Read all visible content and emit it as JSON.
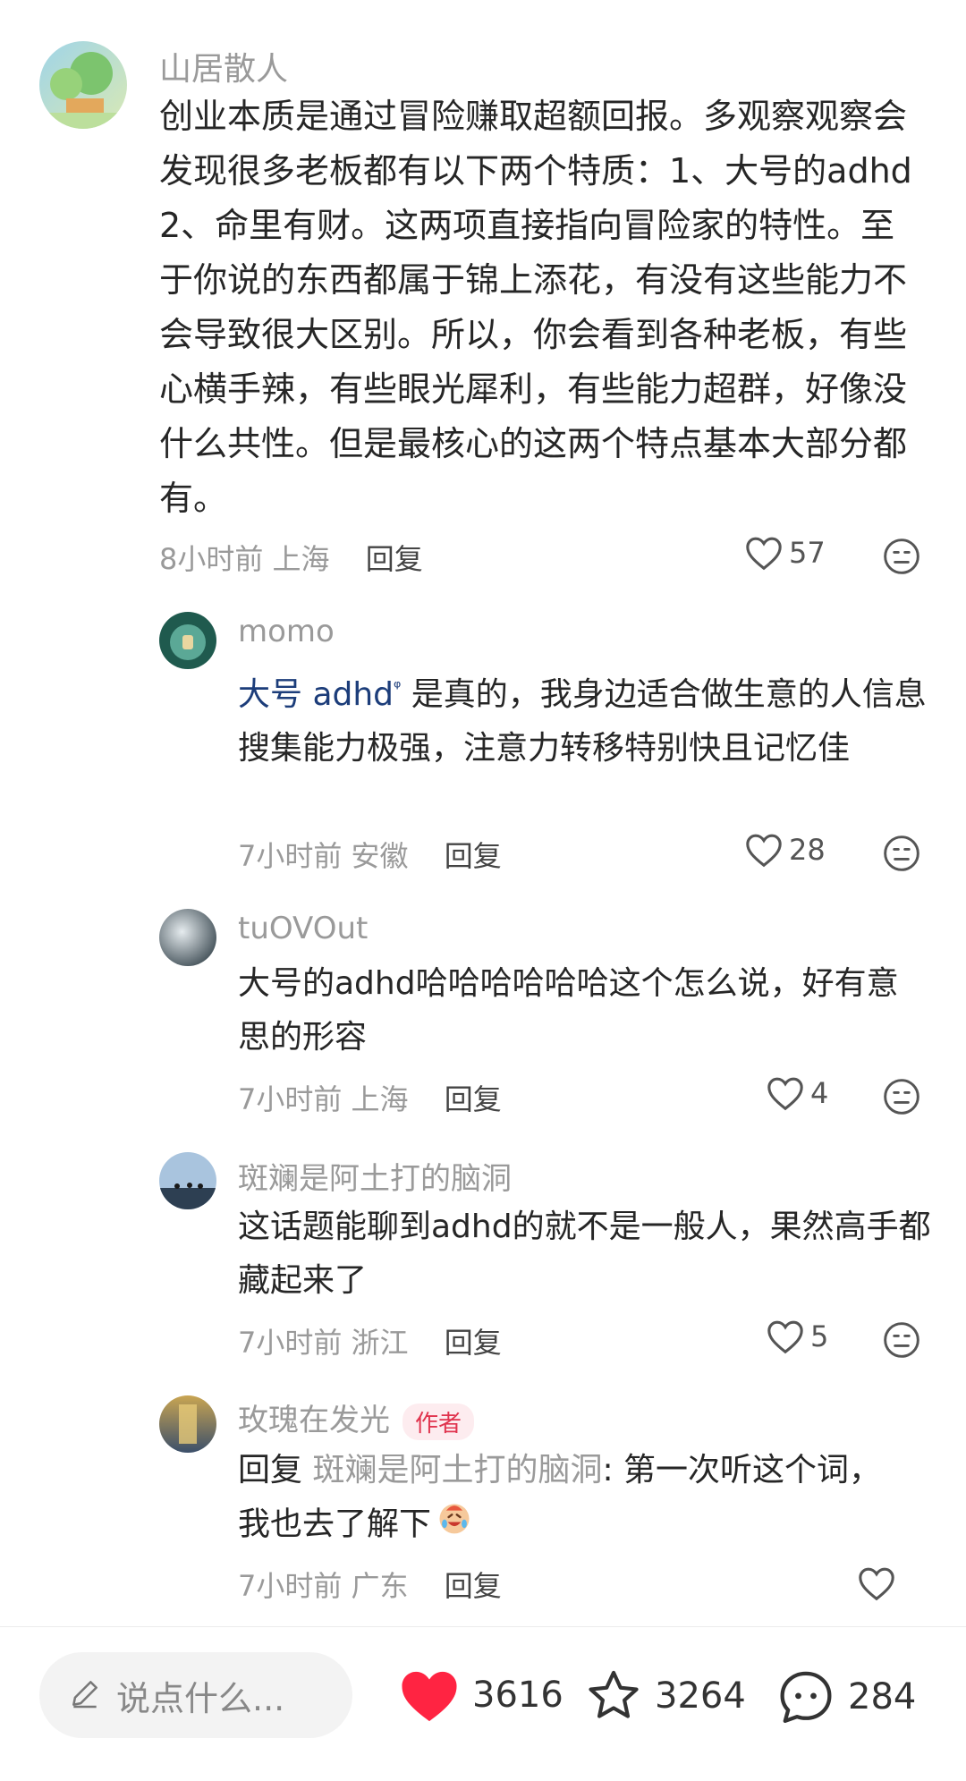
{
  "comments": [
    {
      "username": "山居散人",
      "text": "创业本质是通过冒险赚取超额回报。多观察观察会发现很多老板都有以下两个特质：1、大号的adhd  2、命里有财。这两项直接指向冒险家的特性。至于你说的东西都属于锦上添花，有没有这些能力不会导致很大区别。所以，你会看到各种老板，有些心横手辣，有些眼光犀利，有些能力超群，好像没什么共性。但是最核心的这两个特点基本大部分都有。",
      "time": "8小时前",
      "location": "上海",
      "reply": "回复",
      "likes": "57"
    },
    {
      "username": "momo",
      "highlight": "大号 adhd",
      "text": " 是真的，我身边适合做生意的人信息搜集能力极强，注意力转移特别快且记忆佳",
      "time": "7小时前",
      "location": "安徽",
      "reply": "回复",
      "likes": "28"
    },
    {
      "username": "tuOVOut",
      "text": "大号的adhd哈哈哈哈哈哈这个怎么说，好有意思的形容",
      "time": "7小时前",
      "location": "上海",
      "reply": "回复",
      "likes": "4"
    },
    {
      "username": "斑斓是阿土打的脑洞",
      "text": "这话题能聊到adhd的就不是一般人，果然高手都藏起来了",
      "time": "7小时前",
      "location": "浙江",
      "reply": "回复",
      "likes": "5"
    },
    {
      "username": "玫瑰在发光",
      "author_tag": "作者",
      "reply_prefix": "回复 ",
      "reply_target": "斑斓是阿土打的脑洞",
      "text": ": 第一次听这个词，我也去了解下",
      "time": "7小时前",
      "location": "广东",
      "reply": "回复"
    }
  ],
  "bottom_bar": {
    "input_placeholder": "说点什么...",
    "likes": "3616",
    "favorites": "3264",
    "comments": "284"
  },
  "colors": {
    "like_red": "#ff2442",
    "link_blue": "#1c3d7a",
    "author_tag_red": "#e0344e"
  },
  "icons": [
    "pencil-icon",
    "heart-icon",
    "star-icon",
    "chat-bubble-icon",
    "dislike-face-icon",
    "crying-laugh-emoji"
  ]
}
